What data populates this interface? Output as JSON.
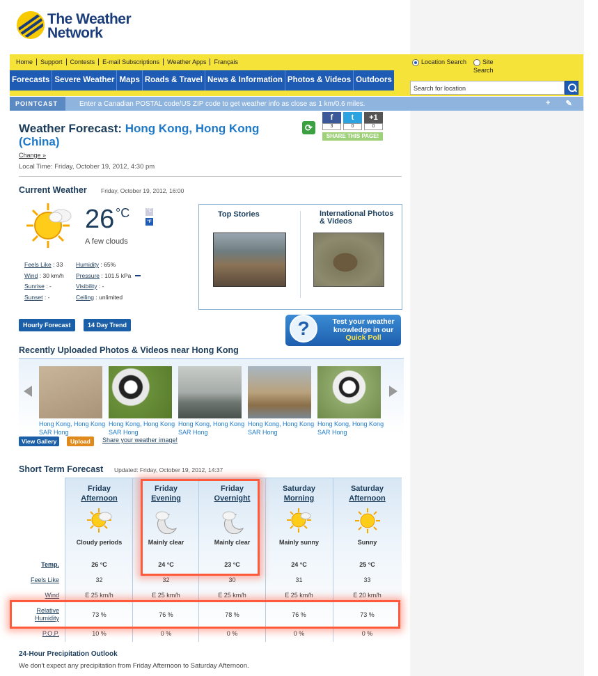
{
  "logo": {
    "line1": "The Weather",
    "line2": "Network"
  },
  "toplinks": [
    "Home",
    "Support",
    "Contests",
    "E-mail Subscriptions",
    "Weather Apps",
    "Français"
  ],
  "mainnav": [
    "Forecasts",
    "Severe Weather",
    "Maps",
    "Roads & Travel",
    "News & Information",
    "Photos & Videos",
    "Outdoors"
  ],
  "search": {
    "option_location": "Location Search",
    "option_site": "Site Search",
    "placeholder": "Search for location"
  },
  "pointcast": {
    "logo": "POINTCAST",
    "text": "Enter a Canadian POSTAL code/US ZIP code to get weather info as close as 1 km/0.6 miles.",
    "plus": "+",
    "pen": "✎"
  },
  "header": {
    "prefix": "Weather Forecast:",
    "city": "Hong Kong, Hong Kong (China)",
    "change": "Change »",
    "localtime": "Local Time: Friday, October 19, 2012, 4:30 pm"
  },
  "social": {
    "fb_count": "3",
    "tw_count": "0",
    "gp_count": "0",
    "gp_label": "+1",
    "share": "SHARE THIS PAGE!"
  },
  "current": {
    "title": "Current Weather",
    "date": "Friday, October 19, 2012, 16:00",
    "temp": "26",
    "unit": "°C",
    "cond": "A few clouds",
    "toggle_c": "°C",
    "toggle_f": "°F",
    "left": [
      {
        "label": "Feels Like",
        "value": ": 33"
      },
      {
        "label": "Wind",
        "value": ":  30 km/h"
      },
      {
        "label": "Sunrise",
        "value": ": -"
      },
      {
        "label": "Sunset",
        "value": ": -"
      }
    ],
    "right": [
      {
        "label": "Humidity",
        "value": ": 65%"
      },
      {
        "label": "Pressure",
        "value": ": 101.5 kPa"
      },
      {
        "label": "Visibility",
        "value": ": -"
      },
      {
        "label": "Ceiling",
        "value": ": unlimited"
      }
    ]
  },
  "stories": {
    "top": "Top Stories",
    "intl": "International Photos & Videos"
  },
  "buttons": {
    "hourly": "Hourly Forecast",
    "trend": "14 Day Trend",
    "gallery": "View Gallery",
    "upload": "Upload",
    "share_image": "Share your weather image!"
  },
  "quickpoll": {
    "line1": "Test your weather",
    "line2": "knowledge in our",
    "line3": "Quick Poll"
  },
  "gallery": {
    "title": "Recently Uploaded Photos & Videos near Hong Kong",
    "captions": [
      "Hong Kong, Hong Kong SAR Hong",
      "Hong Kong, Hong Kong SAR Hong",
      "Hong Kong, Hong Kong SAR Hong",
      "Hong Kong, Hong Kong SAR Hong",
      "Hong Kong, Hong Kong SAR Hong"
    ]
  },
  "short": {
    "title": "Short Term Forecast",
    "updated": "Updated: Friday, October 19, 2012, 14:37",
    "labels": {
      "temp": "Temp.",
      "feels": "Feels Like",
      "wind": "Wind",
      "hum1": "Relative",
      "hum2": "Humidity",
      "pop": "P.O.P."
    },
    "periods": [
      {
        "d": "Friday",
        "p": "Afternoon",
        "cond": "Cloudy periods",
        "temp": "26 °C",
        "feels": "32",
        "wind": "E  25 km/h",
        "hum": "73  %",
        "pop": "10  %"
      },
      {
        "d": "Friday",
        "p": "Evening",
        "cond": "Mainly clear",
        "temp": "24 °C",
        "feels": "32",
        "wind": "E  25 km/h",
        "hum": "76  %",
        "pop": "0  %"
      },
      {
        "d": "Friday",
        "p": "Overnight",
        "cond": "Mainly clear",
        "temp": "23 °C",
        "feels": "30",
        "wind": "E  25 km/h",
        "hum": "78  %",
        "pop": "0  %"
      },
      {
        "d": "Saturday",
        "p": "Morning",
        "cond": "Mainly sunny",
        "temp": "24 °C",
        "feels": "31",
        "wind": "E  25 km/h",
        "hum": "76  %",
        "pop": "0  %"
      },
      {
        "d": "Saturday",
        "p": "Afternoon",
        "cond": "Sunny",
        "temp": "25 °C",
        "feels": "33",
        "wind": "E  20 km/h",
        "hum": "73  %",
        "pop": "0  %"
      }
    ]
  },
  "precip": {
    "title": "24-Hour Precipitation Outlook",
    "text": "We don't expect any precipitation from Friday Afternoon to Saturday Afternoon."
  }
}
